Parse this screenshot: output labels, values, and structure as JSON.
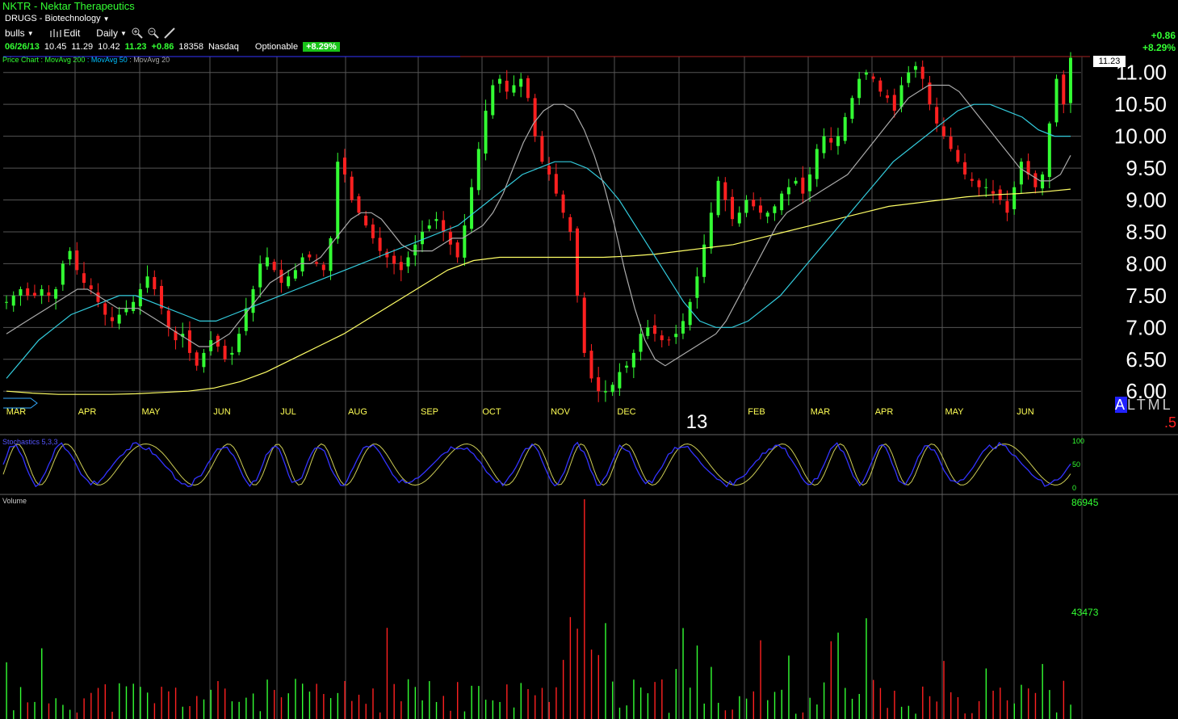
{
  "header": {
    "title": "NKTR - Nektar Therapeutics",
    "sector": "DRUGS - Biotechnology",
    "watchlist": "bulls",
    "edit": "Edit",
    "period": "Daily"
  },
  "quote": {
    "date": "06/26/13",
    "open": "10.45",
    "high": "11.29",
    "low": "10.42",
    "close": "11.23",
    "change": "+0.86",
    "volume": "18358",
    "exchange": "Nasdaq",
    "optionable": "Optionable",
    "pct_change": "+8.29%"
  },
  "right_change": {
    "abs": "+0.86",
    "pct": "+8.29%"
  },
  "legend": {
    "price_chart": "Price Chart",
    "ma200": "MovAvg 200",
    "ma50": "MovAvg 50",
    "ma20": "MovAvg 20",
    "stochastics": "Stochastics 5,3,3",
    "volume": "Volume"
  },
  "last_price_box": "11.23",
  "year_label": "13",
  "range_selector": {
    "selected": "A",
    "rest": "LTML"
  },
  "small_red": ".5",
  "colors": {
    "up": "#33ff33",
    "down": "#ff2020",
    "ma200": "#ffff66",
    "ma50": "#33ccdd",
    "ma20": "#aaaaaa",
    "stoch_k": "#3333ff",
    "stoch_d": "#cccc55",
    "grid": "#555555"
  },
  "chart_data": {
    "type": "line",
    "title": "NKTR - Nektar Therapeutics",
    "x_labels": [
      "MAR",
      "APR",
      "MAY",
      "JUN",
      "JUL",
      "AUG",
      "SEP",
      "OCT",
      "NOV",
      "DEC",
      "FEB",
      "MAR",
      "APR",
      "MAY",
      "JUN"
    ],
    "y_ticks": [
      "11.00",
      "10.50",
      "10.00",
      "9.50",
      "9.00",
      "8.50",
      "8.00",
      "7.50",
      "7.00",
      "6.50",
      "6.00"
    ],
    "ylim": [
      5.8,
      11.25
    ],
    "price_series": [
      7.4,
      7.5,
      7.6,
      7.5,
      7.5,
      7.6,
      7.5,
      7.6,
      8.0,
      8.2,
      7.9,
      7.7,
      7.6,
      7.4,
      7.2,
      7.1,
      7.2,
      7.3,
      7.4,
      7.6,
      7.8,
      7.6,
      7.3,
      7.0,
      6.8,
      6.9,
      6.6,
      6.4,
      6.6,
      6.8,
      6.7,
      6.5,
      6.6,
      6.9,
      7.3,
      7.6,
      8.0,
      8.1,
      7.9,
      7.7,
      7.8,
      7.9,
      8.1,
      8.1,
      8.0,
      7.9,
      8.4,
      9.6,
      9.4,
      9.0,
      8.8,
      8.6,
      8.4,
      8.2,
      8.1,
      8.0,
      7.9,
      8.1,
      8.3,
      8.5,
      8.6,
      8.7,
      8.5,
      8.3,
      8.1,
      8.6,
      9.2,
      9.8,
      10.4,
      10.8,
      10.9,
      10.7,
      10.8,
      10.9,
      10.6,
      10.0,
      9.6,
      9.4,
      9.1,
      8.8,
      8.5,
      7.5,
      6.6,
      6.2,
      6.0,
      6.0,
      6.1,
      6.3,
      6.4,
      6.6,
      6.9,
      7.0,
      6.9,
      6.8,
      6.8,
      6.9,
      7.1,
      7.4,
      7.8,
      8.3,
      8.8,
      9.3,
      9.0,
      8.7,
      8.8,
      9.0,
      8.9,
      8.8,
      8.8,
      8.9,
      9.1,
      9.2,
      9.3,
      9.1,
      9.4,
      9.8,
      10.0,
      9.9,
      10.0,
      10.3,
      10.6,
      10.9,
      11.0,
      10.9,
      10.7,
      10.6,
      10.4,
      10.8,
      11.0,
      11.1,
      10.9,
      10.5,
      10.2,
      10.0,
      9.8,
      9.6,
      9.4,
      9.3,
      9.2,
      9.2,
      9.1,
      9.0,
      8.8,
      9.2,
      9.6,
      9.4,
      9.2,
      9.4,
      10.2,
      10.9,
      10.5,
      11.23
    ],
    "ma20": [
      6.9,
      7.0,
      7.1,
      7.2,
      7.3,
      7.4,
      7.5,
      7.6,
      7.6,
      7.5,
      7.4,
      7.3,
      7.3,
      7.3,
      7.2,
      7.1,
      7.0,
      6.9,
      6.8,
      6.7,
      6.7,
      6.8,
      6.9,
      7.1,
      7.3,
      7.5,
      7.7,
      7.8,
      7.9,
      8.0,
      8.0,
      8.1,
      8.3,
      8.5,
      8.7,
      8.8,
      8.8,
      8.7,
      8.5,
      8.3,
      8.2,
      8.2,
      8.2,
      8.3,
      8.4,
      8.4,
      8.5,
      8.6,
      8.8,
      9.1,
      9.5,
      9.9,
      10.2,
      10.4,
      10.5,
      10.5,
      10.4,
      10.1,
      9.7,
      9.2,
      8.6,
      7.9,
      7.3,
      6.8,
      6.5,
      6.4,
      6.5,
      6.6,
      6.7,
      6.8,
      6.9,
      7.1,
      7.4,
      7.7,
      8.0,
      8.3,
      8.6,
      8.8,
      8.9,
      9.0,
      9.1,
      9.2,
      9.3,
      9.4,
      9.6,
      9.8,
      10.0,
      10.2,
      10.4,
      10.6,
      10.7,
      10.8,
      10.8,
      10.8,
      10.7,
      10.5,
      10.3,
      10.1,
      9.9,
      9.7,
      9.5,
      9.4,
      9.3,
      9.3,
      9.4,
      9.7
    ],
    "ma50": [
      6.2,
      6.5,
      6.8,
      7.0,
      7.2,
      7.3,
      7.4,
      7.5,
      7.5,
      7.4,
      7.3,
      7.2,
      7.1,
      7.1,
      7.2,
      7.3,
      7.4,
      7.5,
      7.6,
      7.7,
      7.8,
      7.9,
      8.0,
      8.1,
      8.2,
      8.3,
      8.4,
      8.5,
      8.6,
      8.8,
      9.0,
      9.2,
      9.4,
      9.5,
      9.6,
      9.6,
      9.5,
      9.3,
      9.0,
      8.6,
      8.2,
      7.8,
      7.4,
      7.1,
      7.0,
      7.0,
      7.1,
      7.3,
      7.5,
      7.8,
      8.1,
      8.4,
      8.7,
      9.0,
      9.3,
      9.6,
      9.8,
      10.0,
      10.2,
      10.4,
      10.5,
      10.5,
      10.4,
      10.3,
      10.1,
      10.0,
      10.0
    ],
    "ma200": [
      6.0,
      5.97,
      5.95,
      5.95,
      5.95,
      5.96,
      5.98,
      6.0,
      6.05,
      6.15,
      6.3,
      6.5,
      6.7,
      6.9,
      7.15,
      7.4,
      7.65,
      7.9,
      8.05,
      8.1,
      8.1,
      8.1,
      8.1,
      8.1,
      8.12,
      8.15,
      8.2,
      8.25,
      8.3,
      8.4,
      8.5,
      8.6,
      8.7,
      8.8,
      8.9,
      8.95,
      9.0,
      9.05,
      9.08,
      9.1,
      9.13,
      9.17
    ],
    "stochastics": {
      "levels": [
        "100",
        "50",
        "0"
      ]
    },
    "volume": {
      "ticks": [
        "86945",
        "43473"
      ],
      "max": 86945
    }
  }
}
